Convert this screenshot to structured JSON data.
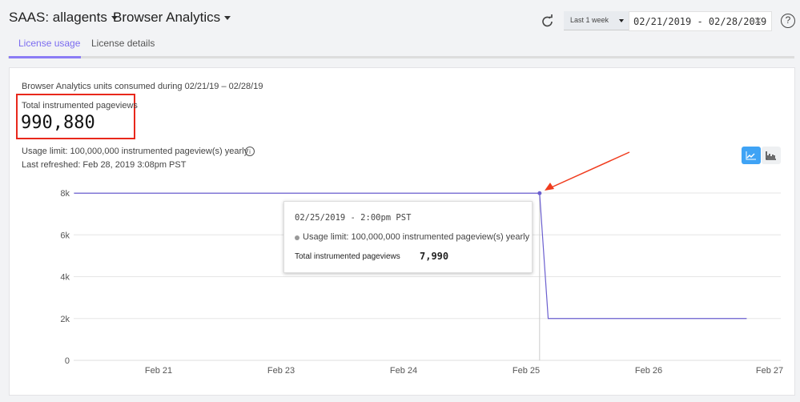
{
  "header": {
    "account": "SAAS: allagents",
    "product": "Browser Analytics",
    "range_select": "Last 1 week",
    "date_range": "02/21/2019 - 02/28/2019"
  },
  "tabs": [
    {
      "label": "License usage",
      "active": true
    },
    {
      "label": "License details",
      "active": false
    }
  ],
  "summary": {
    "consumed_label": "Browser Analytics units consumed during 02/21/19 – 02/28/19",
    "total_label": "Total instrumented pageviews",
    "total_value": "990,880",
    "usage_limit": "Usage limit: 100,000,000 instrumented pageview(s) yearly",
    "last_refreshed": "Last refreshed: Feb 28, 2019 3:08pm PST"
  },
  "tooltip": {
    "time": "02/25/2019 - 2:00pm PST",
    "limit": "Usage limit: 100,000,000 instrumented pageview(s) yearly",
    "metric_label": "Total instrumented pageviews",
    "metric_value": "7,990"
  },
  "colors": {
    "accent": "#7b6cf0",
    "line": "#6b5fcf",
    "annotation": "#f03c1e",
    "chart_toggle_active": "#3fa3f5"
  },
  "chart_data": {
    "type": "line",
    "y_ticks": [
      "0",
      "2k",
      "4k",
      "6k",
      "8k"
    ],
    "ylim": [
      0,
      8000
    ],
    "x_ticks": [
      {
        "label": "Feb 21",
        "day": 22
      },
      {
        "label": "Feb 23",
        "day": 23
      },
      {
        "label": "Feb 24",
        "day": 24
      },
      {
        "label": "Feb 25",
        "day": 25
      },
      {
        "label": "Feb 26",
        "day": 26
      },
      {
        "label": "Feb 27",
        "day": 27
      }
    ],
    "series": [
      {
        "points": [
          [
            21.31,
            7990
          ],
          [
            25.11,
            7990
          ],
          [
            25.18,
            2000
          ],
          [
            26.8,
            2000
          ]
        ]
      }
    ],
    "highlight": {
      "day": 25.11,
      "value": 7990
    },
    "grid": true
  }
}
